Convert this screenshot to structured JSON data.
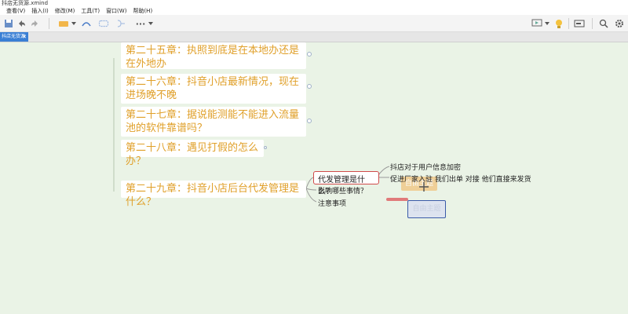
{
  "window": {
    "title": "抖店无货源.xmind"
  },
  "menu": [
    "查看(V)",
    "插入(I)",
    "修改(M)",
    "工具(T)",
    "窗口(W)",
    "帮助(H)"
  ],
  "tabs": [
    {
      "label": "抖店无货源"
    }
  ],
  "toolbar": {
    "more_label": "···"
  },
  "topics": [
    "第二十五章：执照到底是在本地办还是在外地办",
    "第二十六章：抖音小店最新情况，现在进场晚不晚",
    "第二十七章：据说能测能不能进入流量池的软件靠谱吗？",
    "第二十八章：遇见打假的怎么办？",
    "第二十九章：抖音小店后台代发管理是什么？"
  ],
  "subtopics": {
    "selected": "代发管理是什么？",
    "impact": "影响哪些事情？",
    "notes": "注意事项",
    "info_encrypt": "抖店对于用户信息加密",
    "flow": "促进厂家入驻  我们出单  对接  他们直接来发货"
  },
  "ghost_labels": [
    "自由主题",
    "自由主题"
  ],
  "colors": {
    "topic_text": "#e0a02a",
    "canvas": "#eaf3e6",
    "tab_active": "#3a7fd5",
    "selected_border": "#d04a4a"
  }
}
